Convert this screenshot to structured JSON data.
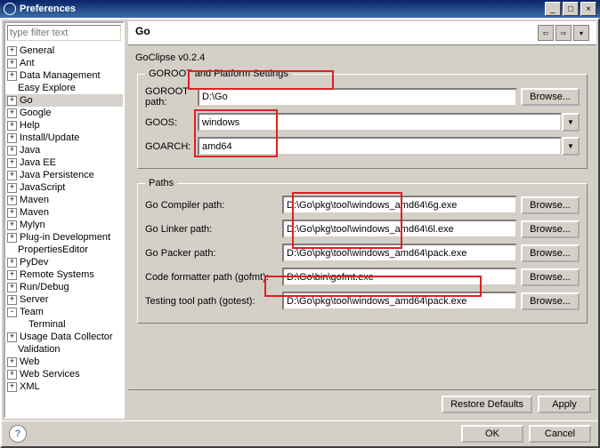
{
  "window": {
    "title": "Preferences",
    "min": "_",
    "max": "□",
    "close": "×"
  },
  "filter_placeholder": "type filter text",
  "tree": [
    {
      "label": "General",
      "exp": "+"
    },
    {
      "label": "Ant",
      "exp": "+"
    },
    {
      "label": "Data Management",
      "exp": "+"
    },
    {
      "label": "Easy Explore",
      "exp": ""
    },
    {
      "label": "Go",
      "exp": "+",
      "sel": true
    },
    {
      "label": "Google",
      "exp": "+"
    },
    {
      "label": "Help",
      "exp": "+"
    },
    {
      "label": "Install/Update",
      "exp": "+"
    },
    {
      "label": "Java",
      "exp": "+"
    },
    {
      "label": "Java EE",
      "exp": "+"
    },
    {
      "label": "Java Persistence",
      "exp": "+"
    },
    {
      "label": "JavaScript",
      "exp": "+"
    },
    {
      "label": "Maven",
      "exp": "+"
    },
    {
      "label": "Maven",
      "exp": "+"
    },
    {
      "label": "Mylyn",
      "exp": "+"
    },
    {
      "label": "Plug-in Development",
      "exp": "+"
    },
    {
      "label": "PropertiesEditor",
      "exp": ""
    },
    {
      "label": "PyDev",
      "exp": "+"
    },
    {
      "label": "Remote Systems",
      "exp": "+"
    },
    {
      "label": "Run/Debug",
      "exp": "+"
    },
    {
      "label": "Server",
      "exp": "+"
    },
    {
      "label": "Team",
      "exp": "-"
    },
    {
      "label": "Terminal",
      "exp": "",
      "indent": true
    },
    {
      "label": "Usage Data Collector",
      "exp": "+"
    },
    {
      "label": "Validation",
      "exp": ""
    },
    {
      "label": "Web",
      "exp": "+"
    },
    {
      "label": "Web Services",
      "exp": "+"
    },
    {
      "label": "XML",
      "exp": "+"
    }
  ],
  "page": {
    "title": "Go",
    "subtitle": "GoClipse v0.2.4",
    "platform": {
      "legend": "GOROOT and Platform Settings",
      "goroot_label": "GOROOT path:",
      "goroot": "D:\\Go",
      "browse": "Browse...",
      "goos_label": "GOOS:",
      "goos": "windows",
      "goarch_label": "GOARCH:",
      "goarch": "amd64"
    },
    "paths": {
      "legend": "Paths",
      "compiler_label": "Go Compiler path:",
      "compiler": "D:\\Go\\pkg\\tool\\windows_amd64\\6g.exe",
      "linker_label": "Go Linker path:",
      "linker": "D:\\Go\\pkg\\tool\\windows_amd64\\6l.exe",
      "packer_label": "Go Packer path:",
      "packer": "D:\\Go\\pkg\\tool\\windows_amd64\\pack.exe",
      "gofmt_label": "Code formatter path (gofmt):",
      "gofmt": "D:\\Go\\bin\\gofmt.exe",
      "gotest_label": "Testing tool path (gotest):",
      "gotest": "D:\\Go\\pkg\\tool\\windows_amd64\\pack.exe",
      "browse": "Browse..."
    },
    "restore": "Restore Defaults",
    "apply": "Apply"
  },
  "footer": {
    "ok": "OK",
    "cancel": "Cancel",
    "help": "?"
  }
}
